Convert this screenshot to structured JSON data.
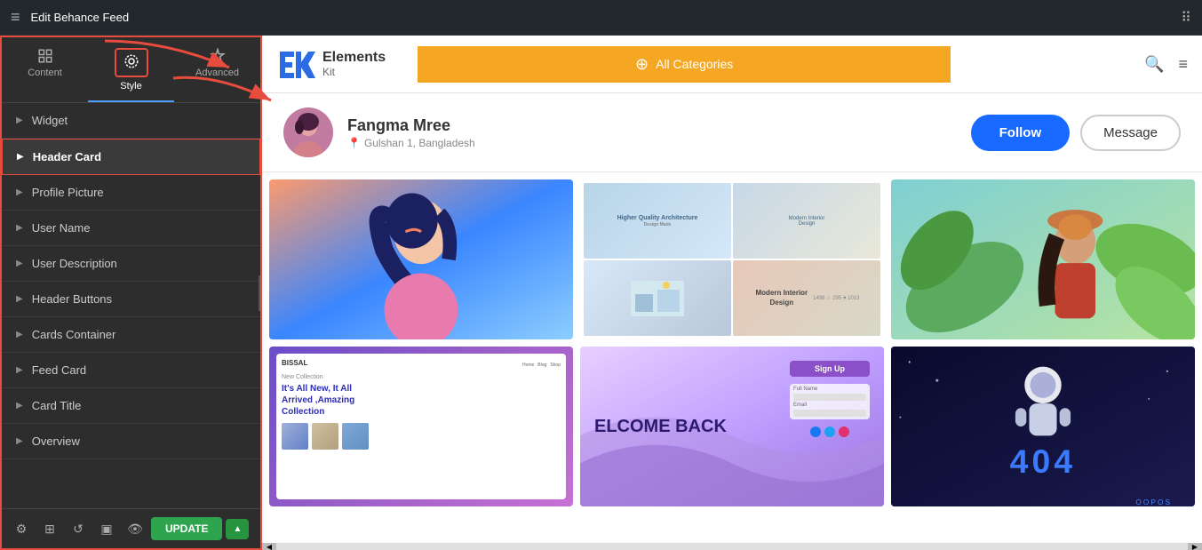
{
  "topbar": {
    "title": "Edit Behance Feed",
    "hamburger_icon": "≡",
    "grid_icon": "⠿"
  },
  "sidebar": {
    "tabs": [
      {
        "id": "content",
        "label": "Content",
        "active": false
      },
      {
        "id": "style",
        "label": "Style",
        "active": true
      },
      {
        "id": "advanced",
        "label": "Advanced",
        "active": false
      }
    ],
    "items": [
      {
        "id": "widget",
        "label": "Widget",
        "highlighted": false
      },
      {
        "id": "header-card",
        "label": "Header Card",
        "highlighted": true
      },
      {
        "id": "profile-picture",
        "label": "Profile Picture",
        "highlighted": false
      },
      {
        "id": "user-name",
        "label": "User Name",
        "highlighted": false
      },
      {
        "id": "user-description",
        "label": "User Description",
        "highlighted": false
      },
      {
        "id": "header-buttons",
        "label": "Header Buttons",
        "highlighted": false
      },
      {
        "id": "cards-container",
        "label": "Cards Container",
        "highlighted": false
      },
      {
        "id": "feed-card",
        "label": "Feed Card",
        "highlighted": false
      },
      {
        "id": "card-title",
        "label": "Card Title",
        "highlighted": false
      },
      {
        "id": "overview",
        "label": "Overview",
        "highlighted": false
      }
    ],
    "bottom": {
      "update_label": "UPDATE"
    }
  },
  "preview": {
    "logo": {
      "brand": "Elements",
      "sub": "Kit",
      "icon": "EK"
    },
    "nav": {
      "all_categories": "All Categories",
      "plus_icon": "⊕"
    },
    "profile": {
      "name": "Fangma Mree",
      "location": "Gulshan 1, Bangladesh",
      "follow_label": "Follow",
      "message_label": "Message"
    },
    "cards": [
      {
        "id": "card1",
        "type": "illustration-girl"
      },
      {
        "id": "card2",
        "type": "architecture",
        "interior_text": "Modern Interior\nDesign"
      },
      {
        "id": "card3",
        "type": "tropical-woman"
      },
      {
        "id": "card4",
        "type": "bissal",
        "brand": "BISSAL",
        "tagline": "It's All New, It All\nArrived ,Amazing\nCollection"
      },
      {
        "id": "card5",
        "type": "welcome",
        "text": "ELCOME BACK",
        "signup": "Sign Up"
      },
      {
        "id": "card6",
        "type": "404",
        "text": "4☺4",
        "sub": "OOPOS"
      }
    ],
    "bottom_scroll": {
      "left_arrow": "◀",
      "right_arrow": "▶"
    }
  }
}
